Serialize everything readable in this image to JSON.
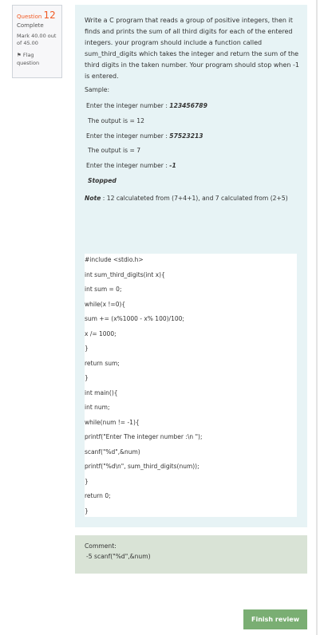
{
  "info": {
    "question_label": "Question",
    "question_number": "12",
    "state": "Complete",
    "mark": "Mark 40.00 out of 45.00",
    "flag": "Flag question",
    "flag_icon": "flag-icon"
  },
  "question": {
    "text": "Write a C program that reads a group of positive integers, then it finds and prints the sum of all third digits for each of the entered integers. your program should include a function called sum_third_digits which takes the integer and return the sum of the third digits in the taken number. Your program should stop when -1 is entered.",
    "sample_label": "Sample:",
    "lines": [
      {
        "text": "Enter the integer number : ",
        "em": "123456789"
      },
      {
        "text": "The output is = 12",
        "em": ""
      },
      {
        "text": "Enter the integer number : ",
        "em": "57523213"
      },
      {
        "text": "The output is = 7",
        "em": ""
      },
      {
        "text": "Enter the integer number : ",
        "em": "-1"
      },
      {
        "text": "",
        "em": "Stopped"
      }
    ],
    "note_label": "Note",
    "note": " : 12 calculateted from (7+4+1), and  7 calculated from (2+5)"
  },
  "answer_code": [
    "#include <stdio.h>",
    "int sum_third_digits(int x){",
    "int sum = 0;",
    "while(x !=0){",
    "sum += (x%1000 - x% 100)/100;",
    "x /= 1000;",
    "}",
    "return sum;",
    "}",
    "int main(){",
    "int num;",
    "while(num != -1){",
    "printf(\"Enter The integer number :\\n \");",
    "scanf(\"%d\",&num)",
    "printf(\"%d\\n\", sum_third_digits(num));",
    "}",
    "return 0;",
    "}"
  ],
  "comment": {
    "label": "Comment:",
    "text": "-5 scanf(\"%d\",&num)"
  },
  "finish_review": "Finish review",
  "colors": {
    "accent": "#f15a24",
    "content_bg": "#e7f3f5",
    "comment_bg": "#d9e3d6",
    "button": "#7aae73"
  }
}
